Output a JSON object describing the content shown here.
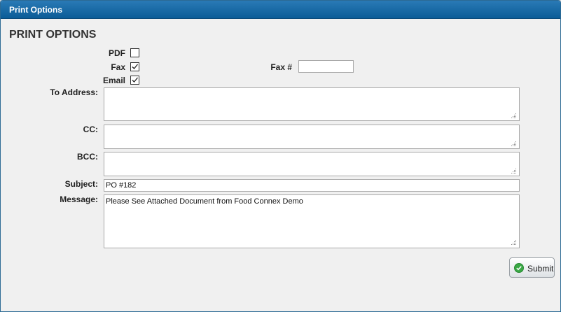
{
  "window": {
    "title": "Print Options"
  },
  "form": {
    "heading": "PRINT OPTIONS",
    "pdf": {
      "label": "PDF",
      "checked": false
    },
    "fax": {
      "label": "Fax",
      "checked": true
    },
    "email": {
      "label": "Email",
      "checked": true
    },
    "fax_number": {
      "label": "Fax #",
      "value": ""
    },
    "to_address": {
      "label": "To Address:",
      "value": ""
    },
    "cc": {
      "label": "CC:",
      "value": ""
    },
    "bcc": {
      "label": "BCC:",
      "value": ""
    },
    "subject": {
      "label": "Subject:",
      "value": "PO #182"
    },
    "message": {
      "label": "Message:",
      "value": "Please See Attached Document from Food Connex Demo"
    }
  },
  "actions": {
    "submit_label": "Submit",
    "submit_icon": "check-circle-icon"
  },
  "colors": {
    "titlebar": "#0b5c97",
    "background": "#f0f0f0",
    "submit_icon": "#3aa845"
  }
}
